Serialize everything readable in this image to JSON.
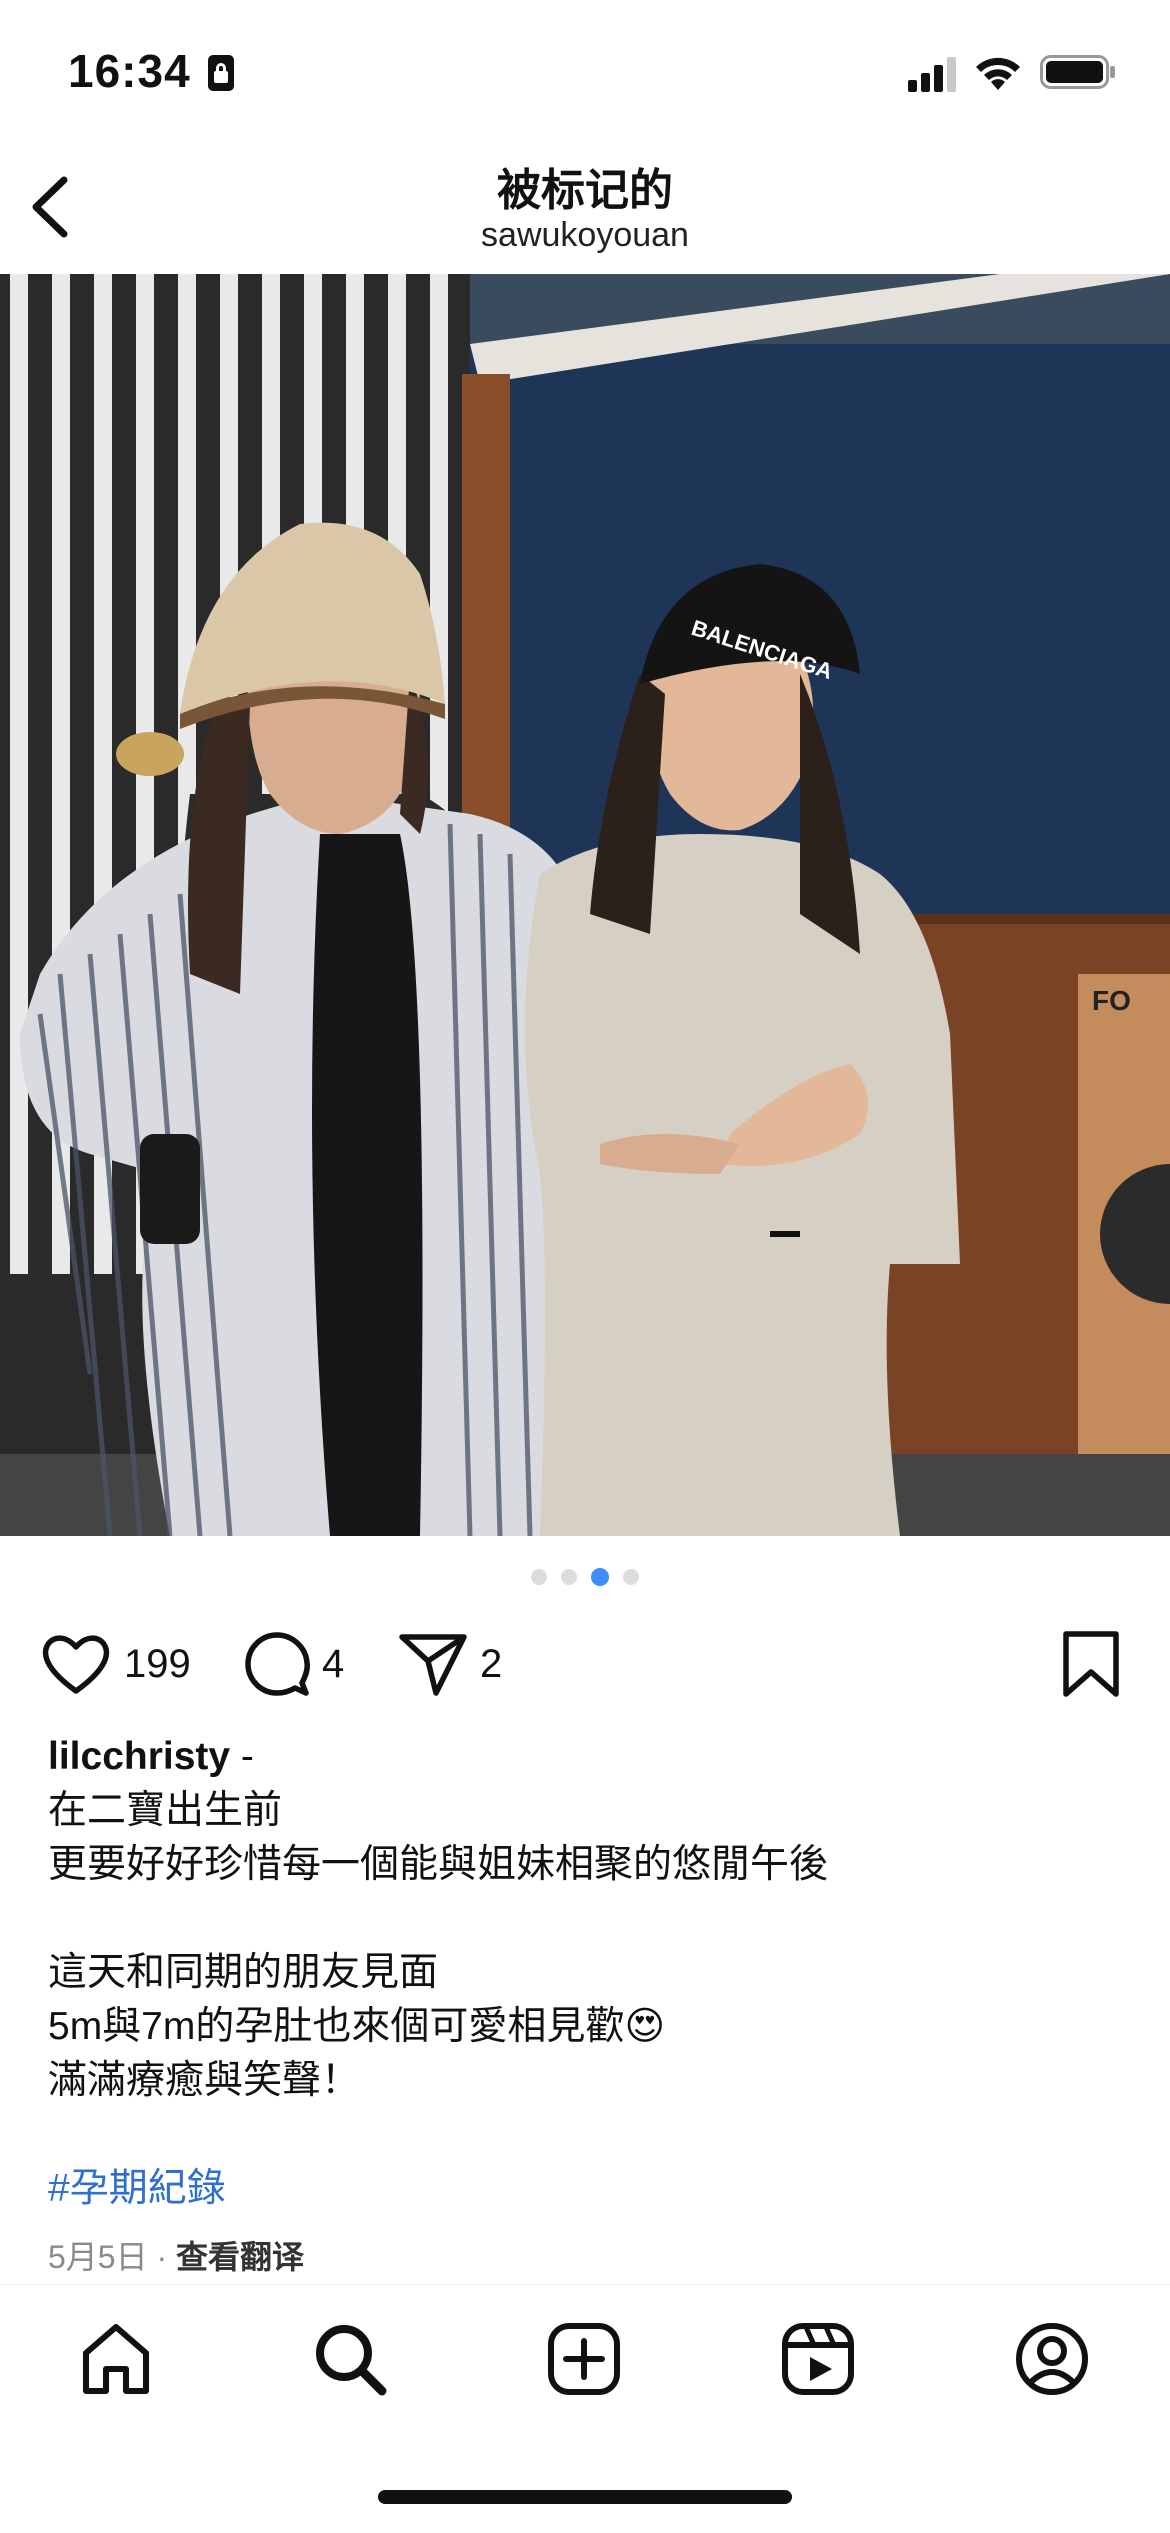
{
  "status_bar": {
    "time": "16:34"
  },
  "header": {
    "title": "被标记的",
    "subtitle": "sawukoyouan"
  },
  "carousel": {
    "total": 4,
    "active_index": 2
  },
  "actions": {
    "likes": "199",
    "comments": "4",
    "shares": "2"
  },
  "caption": {
    "username": "lilcchristy",
    "separator": " -",
    "lines": [
      "在二寶出生前",
      "更要好好珍惜每一個能與姐妹相聚的悠閒午後",
      "",
      "這天和同期的朋友見面",
      "5m與7m的孕肚也來個可愛相見歡😍",
      "滿滿療癒與笑聲！",
      ""
    ],
    "hashtag": "#孕期紀錄"
  },
  "meta": {
    "date": "5月5日",
    "dot": " · ",
    "translate": "查看翻译"
  },
  "photo_text": {
    "cap_text": "BALENCIAGA",
    "poster_text": "FO"
  },
  "colors": {
    "accent": "#3f8ef7",
    "hashtag": "#2f6fd0",
    "wall": "#1f3557"
  },
  "icons": [
    "back-icon",
    "heart-icon",
    "comment-icon",
    "share-icon",
    "bookmark-icon",
    "home-icon",
    "search-icon",
    "create-icon",
    "reels-icon",
    "profile-icon"
  ]
}
